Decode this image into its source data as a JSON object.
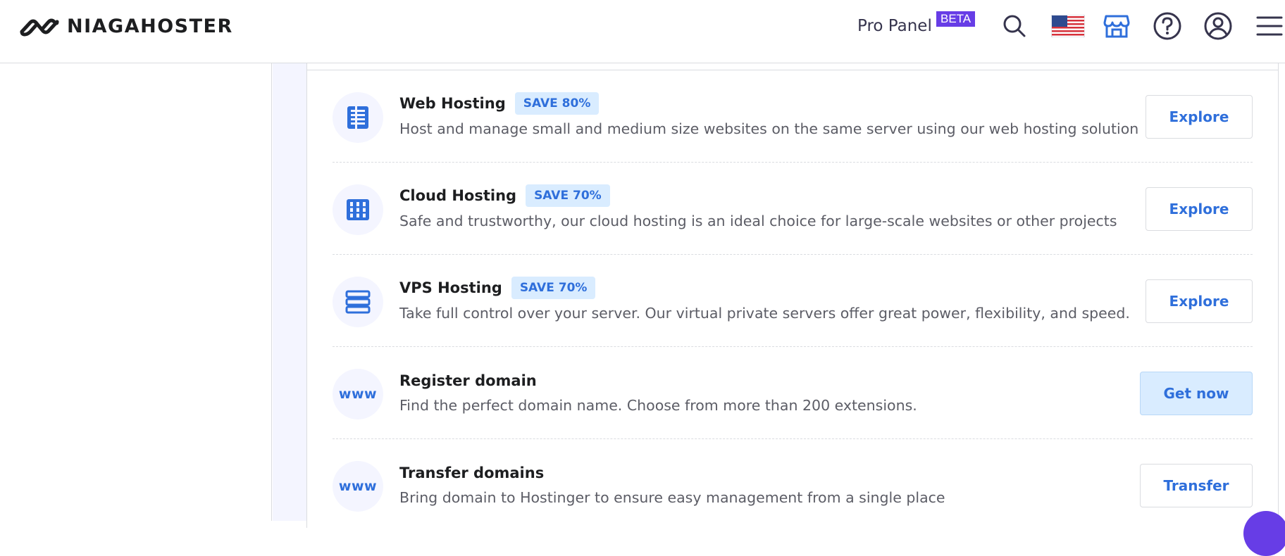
{
  "header": {
    "brand": "NIAGAHOSTER",
    "pro_panel": "Pro Panel",
    "beta_badge": "BETA",
    "icons": [
      "search-icon",
      "us-flag-icon",
      "store-icon",
      "help-icon",
      "account-icon",
      "menu-icon"
    ]
  },
  "products": [
    {
      "title": "Web Hosting",
      "badge": "SAVE 80%",
      "description": "Host and manage small and medium size websites on the same server using our web hosting solution",
      "button": "Explore",
      "icon": "web-hosting-icon"
    },
    {
      "title": "Cloud Hosting",
      "badge": "SAVE 70%",
      "description": "Safe and trustworthy, our cloud hosting is an ideal choice for large-scale websites or other projects",
      "button": "Explore",
      "icon": "cloud-hosting-icon"
    },
    {
      "title": "VPS Hosting",
      "badge": "SAVE 70%",
      "description": "Take full control over your server. Our virtual private servers offer great power, flexibility, and speed.",
      "button": "Explore",
      "icon": "vps-hosting-icon"
    },
    {
      "title": "Register domain",
      "icon_text": "www",
      "description": "Find the perfect domain name. Choose from more than 200 extensions.",
      "button": "Get now",
      "icon": "www-icon"
    },
    {
      "title": "Transfer domains",
      "icon_text": "www",
      "description": "Bring domain to Hostinger to ensure easy management from a single place",
      "button": "Transfer",
      "icon": "www-icon"
    }
  ],
  "colors": {
    "accent": "#2f6fdb",
    "brand_purple": "#673de6",
    "badge_bg": "#d9ecff"
  }
}
